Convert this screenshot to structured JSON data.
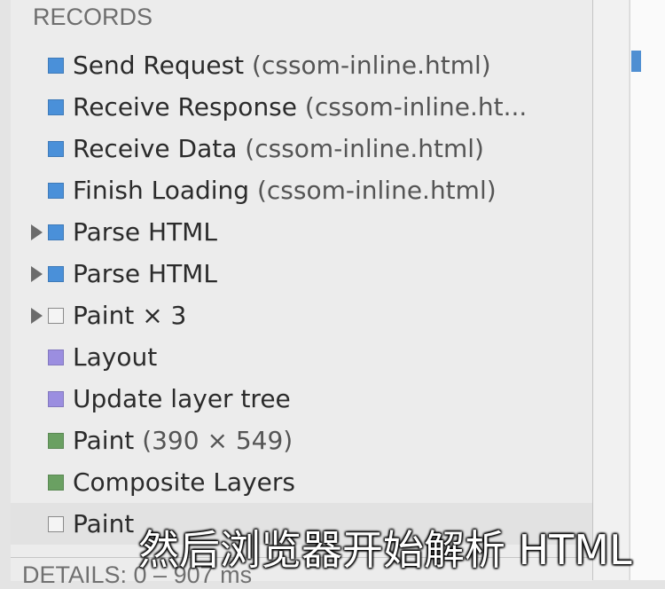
{
  "panel": {
    "header": "RECORDS"
  },
  "records": [
    {
      "name": "Send Request",
      "suffix": " (cssom-inline.html)",
      "color": "#4a90d9",
      "expandable": false
    },
    {
      "name": "Receive Response",
      "suffix": " (cssom-inline.ht...",
      "color": "#4a90d9",
      "expandable": false
    },
    {
      "name": "Receive Data",
      "suffix": " (cssom-inline.html)",
      "color": "#4a90d9",
      "expandable": false
    },
    {
      "name": "Finish Loading",
      "suffix": " (cssom-inline.html)",
      "color": "#4a90d9",
      "expandable": false
    },
    {
      "name": "Parse HTML",
      "suffix": "",
      "color": "#4a90d9",
      "expandable": true
    },
    {
      "name": "Parse HTML",
      "suffix": "",
      "color": "#4a90d9",
      "expandable": true
    },
    {
      "name": "Paint × 3",
      "suffix": "",
      "color": "#f4f4f4",
      "expandable": true,
      "outline": true
    },
    {
      "name": "Layout",
      "suffix": "",
      "color": "#9b8ee0",
      "expandable": false
    },
    {
      "name": "Update layer tree",
      "suffix": "",
      "color": "#9b8ee0",
      "expandable": false
    },
    {
      "name": "Paint",
      "suffix": " (390 × 549)",
      "color": "#6aa062",
      "expandable": false
    },
    {
      "name": "Composite Layers",
      "suffix": "",
      "color": "#6aa062",
      "expandable": false
    },
    {
      "name": "Paint",
      "suffix": "",
      "color": "#f4f4f4",
      "expandable": false,
      "outline": true
    }
  ],
  "details": {
    "label": "DETAILS: 0 – 907 ms"
  },
  "subtitle": "然后浏览器开始解析 HTML"
}
